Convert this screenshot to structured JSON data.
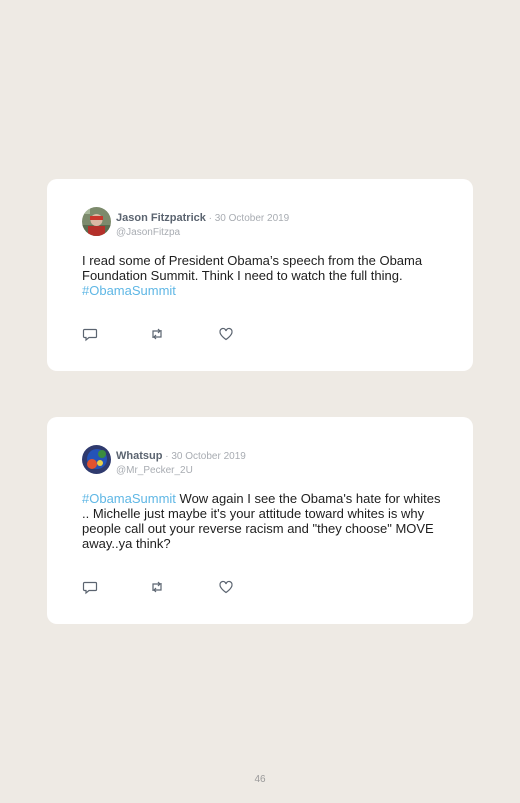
{
  "tweets": [
    {
      "name": "Jason Fitzpatrick",
      "separator": " · ",
      "date": "30 October 2019",
      "handle": "@JasonFitzpa",
      "text_before": "I read some of President Obama’s speech from the Obama Foundation Summit. Think I need to watch the full thing. ",
      "hashtag": "#ObamaSummit",
      "text_after": ""
    },
    {
      "name": "Whatsup",
      "separator": " · ",
      "date": "30 October 2019",
      "handle": "@Mr_Pecker_2U",
      "text_before": "",
      "hashtag": "#ObamaSummit",
      "text_after": " Wow again I see the Obama's hate for whites .. Michelle just maybe it's your attitude toward whites is why people call out your reverse racism and \"they choose\" MOVE away..ya think?"
    }
  ],
  "icons": {
    "reply": "reply-icon",
    "retweet": "retweet-icon",
    "like": "like-icon"
  },
  "colors": {
    "background": "#eeeae4",
    "card": "#ffffff",
    "hashtag": "#5fb7e5",
    "name": "#5b6470",
    "muted": "#a8acb2"
  },
  "page_number": "46"
}
